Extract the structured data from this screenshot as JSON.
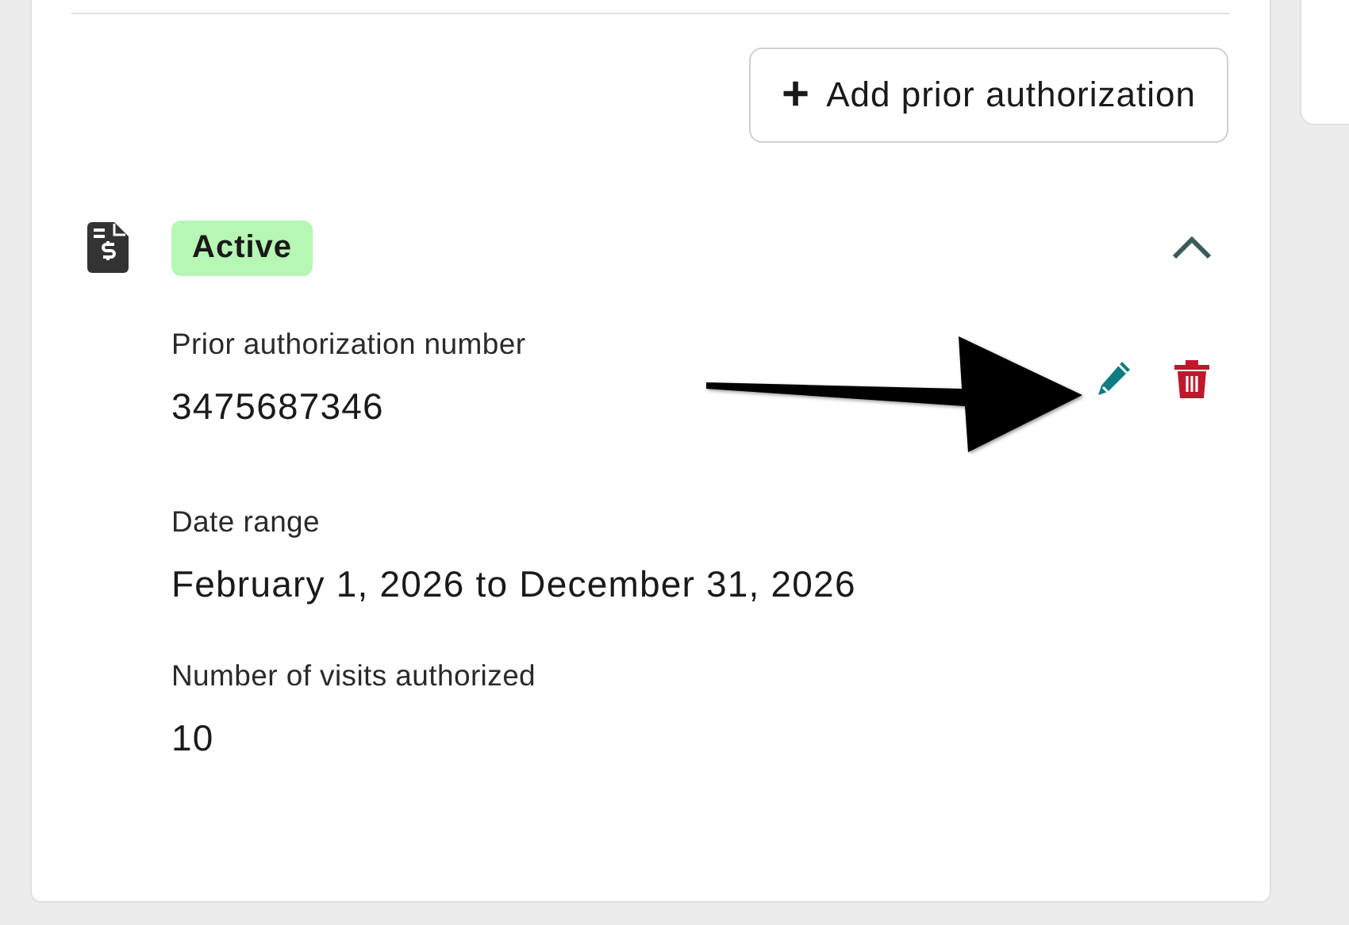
{
  "add_button": {
    "label": "Add prior authorization",
    "icon": "+"
  },
  "authorization": {
    "status": "Active",
    "expanded": true,
    "fields": [
      {
        "label": "Prior authorization number",
        "value": "3475687346"
      },
      {
        "label": "Date range",
        "value": "February 1, 2026 to December 31, 2026"
      },
      {
        "label": "Number of visits authorized",
        "value": "10"
      }
    ]
  }
}
